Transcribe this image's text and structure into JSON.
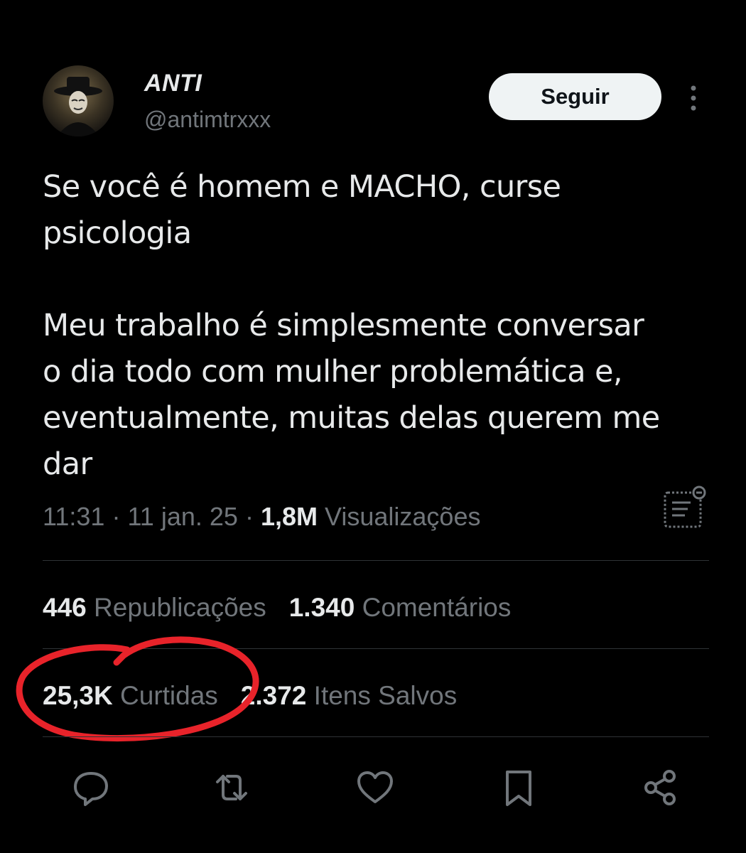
{
  "author": {
    "display_name": "ANTI",
    "handle": "@antimtrxxx"
  },
  "follow_label": "Seguir",
  "tweet": {
    "text": "Se você é homem e MACHO, curse\npsicologia\n\nMeu trabalho é simplesmente conversar\no dia todo com mulher problemática e,\neventualmente, muitas delas querem me\ndar"
  },
  "meta": {
    "time": "11:31",
    "separator": "·",
    "date": "11 jan. 25",
    "views_count": "1,8M",
    "views_label": "Visualizações"
  },
  "stats": {
    "reposts_count": "446",
    "reposts_label": "Republicações",
    "comments_count": "1.340",
    "comments_label": "Comentários",
    "likes_count": "25,3K",
    "likes_label": "Curtidas",
    "bookmarks_count": "2.372",
    "bookmarks_label": "Itens Salvos"
  },
  "actions": [
    "reply-icon",
    "repost-icon",
    "like-icon",
    "bookmark-icon",
    "share-icon"
  ],
  "colors": {
    "background": "#000000",
    "text_primary": "#e7e9ea",
    "text_secondary": "#71767b",
    "divider": "#2f3336",
    "follow_bg": "#eff3f4",
    "annotation": "#e8232a"
  }
}
